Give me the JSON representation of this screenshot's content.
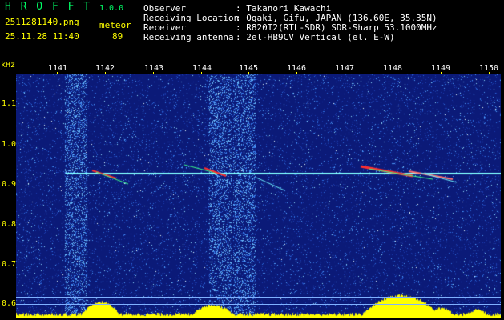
{
  "app": {
    "name": "H R O F F T",
    "version": "1.0.0"
  },
  "file": {
    "name": "2511281140.png",
    "datetime": "25.11.28 11:40"
  },
  "meteor": {
    "label": "meteor",
    "count": "89"
  },
  "info": {
    "observer_label": "Observer",
    "observer_value": ": Takanori Kawachi",
    "location_label": "Receiving Location",
    "location_value": ": Ogaki, Gifu, JAPAN (136.60E, 35.35N)",
    "receiver_label": "Receiver",
    "receiver_value": ": R820T2(RTL-SDR) SDR-Sharp 53.1000MHz",
    "antenna_label": "Receiving antenna",
    "antenna_value": ": 2el-HB9CV Vertical (el. E-W)"
  },
  "axes": {
    "y_unit": "kHz",
    "y_ticks": [
      "1.1",
      "1.0",
      "0.9",
      "0.8",
      "0.7",
      "0.6"
    ],
    "x_ticks": [
      "1141",
      "1142",
      "1143",
      "1144",
      "1145",
      "1146",
      "1147",
      "1148",
      "1149",
      "1150"
    ]
  },
  "colors": {
    "background": "#000000",
    "spectrogram_base": "#0b1a78",
    "trace": "#80ffff",
    "meteor_hot": "#ff3030",
    "profile": "#ffff00"
  }
}
